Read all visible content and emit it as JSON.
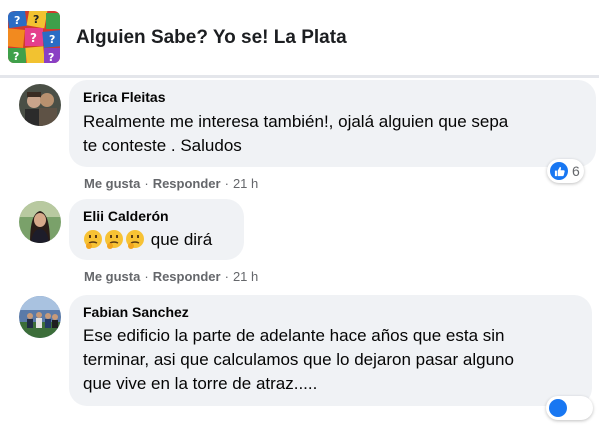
{
  "group": {
    "title": "Alguien Sabe? Yo se! La Plata",
    "avatar_icon": "colorful-question-marks-logo"
  },
  "comments": [
    {
      "author": "Erica Fleitas",
      "lines": [
        "Realmente me interesa también!, ojalá alguien que sepa",
        "te conteste . Saludos"
      ],
      "like_label": "Me gusta",
      "reply_label": "Responder",
      "time": "21 h",
      "reaction_count": "6",
      "reaction_icon": "like-icon"
    },
    {
      "author": "Elii Calderón",
      "emojis": [
        "thinking-face",
        "thinking-face",
        "thinking-face"
      ],
      "text": "que dirá",
      "like_label": "Me gusta",
      "reply_label": "Responder",
      "time": "21 h"
    },
    {
      "author": "Fabian Sanchez",
      "lines": [
        "Ese edificio la parte de adelante hace años que esta sin",
        "terminar, asi que calculamos que lo dejaron pasar alguno",
        "que vive en la torre de atraz....."
      ]
    }
  ],
  "colors": {
    "bubble": "#f0f2f5",
    "meta_text": "#65676b",
    "like_blue": "#1877f2"
  }
}
